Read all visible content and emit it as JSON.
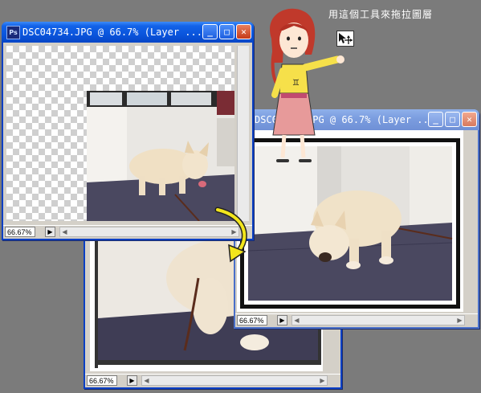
{
  "annotation": {
    "text": "用這個工具來拖拉圖層"
  },
  "windows": {
    "front": {
      "title": "DSC04734.JPG @ 66.7% (Layer ...",
      "zoom": "66.67%"
    },
    "right": {
      "title": "DSC04734.JPG @ 66.7% (Layer ...",
      "zoom": "66.67%"
    },
    "back": {
      "zoom": "66.67%"
    }
  },
  "icons": {
    "move_tool": "move-tool-icon",
    "minimize": "minimize-icon",
    "maximize": "maximize-icon",
    "close": "close-icon",
    "navigator": "navigator-icon",
    "arrow": "curved-arrow"
  },
  "colors": {
    "titlebar": "#0a55dd",
    "desktop": "#7b7b7b",
    "arrow": "#f2e51c",
    "floor": "#4a4860"
  }
}
